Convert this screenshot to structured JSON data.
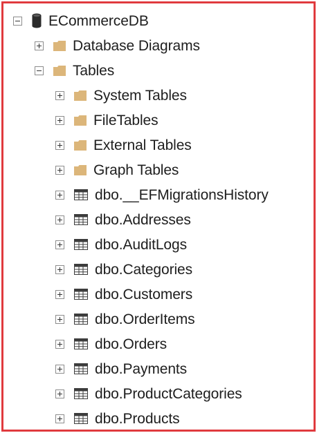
{
  "tree": {
    "root": {
      "label": "ECommerceDB",
      "icon": "database-icon",
      "expanded": true
    },
    "database_diagrams": {
      "label": "Database Diagrams",
      "icon": "folder-icon",
      "expanded": false
    },
    "tables": {
      "label": "Tables",
      "icon": "folder-icon",
      "expanded": true
    },
    "table_children": [
      {
        "label": "System Tables",
        "icon": "folder-icon"
      },
      {
        "label": "FileTables",
        "icon": "folder-icon"
      },
      {
        "label": "External Tables",
        "icon": "folder-icon"
      },
      {
        "label": "Graph Tables",
        "icon": "folder-icon"
      },
      {
        "label": "dbo.__EFMigrationsHistory",
        "icon": "table-icon"
      },
      {
        "label": "dbo.Addresses",
        "icon": "table-icon"
      },
      {
        "label": "dbo.AuditLogs",
        "icon": "table-icon"
      },
      {
        "label": "dbo.Categories",
        "icon": "table-icon"
      },
      {
        "label": "dbo.Customers",
        "icon": "table-icon"
      },
      {
        "label": "dbo.OrderItems",
        "icon": "table-icon"
      },
      {
        "label": "dbo.Orders",
        "icon": "table-icon"
      },
      {
        "label": "dbo.Payments",
        "icon": "table-icon"
      },
      {
        "label": "dbo.ProductCategories",
        "icon": "table-icon"
      },
      {
        "label": "dbo.Products",
        "icon": "table-icon"
      }
    ]
  },
  "colors": {
    "border": "#e03a3e",
    "folder": "#dcb67a",
    "database": "#2b2b2b",
    "table_icon": "#3c3c3c",
    "text": "#1e1e1e"
  }
}
